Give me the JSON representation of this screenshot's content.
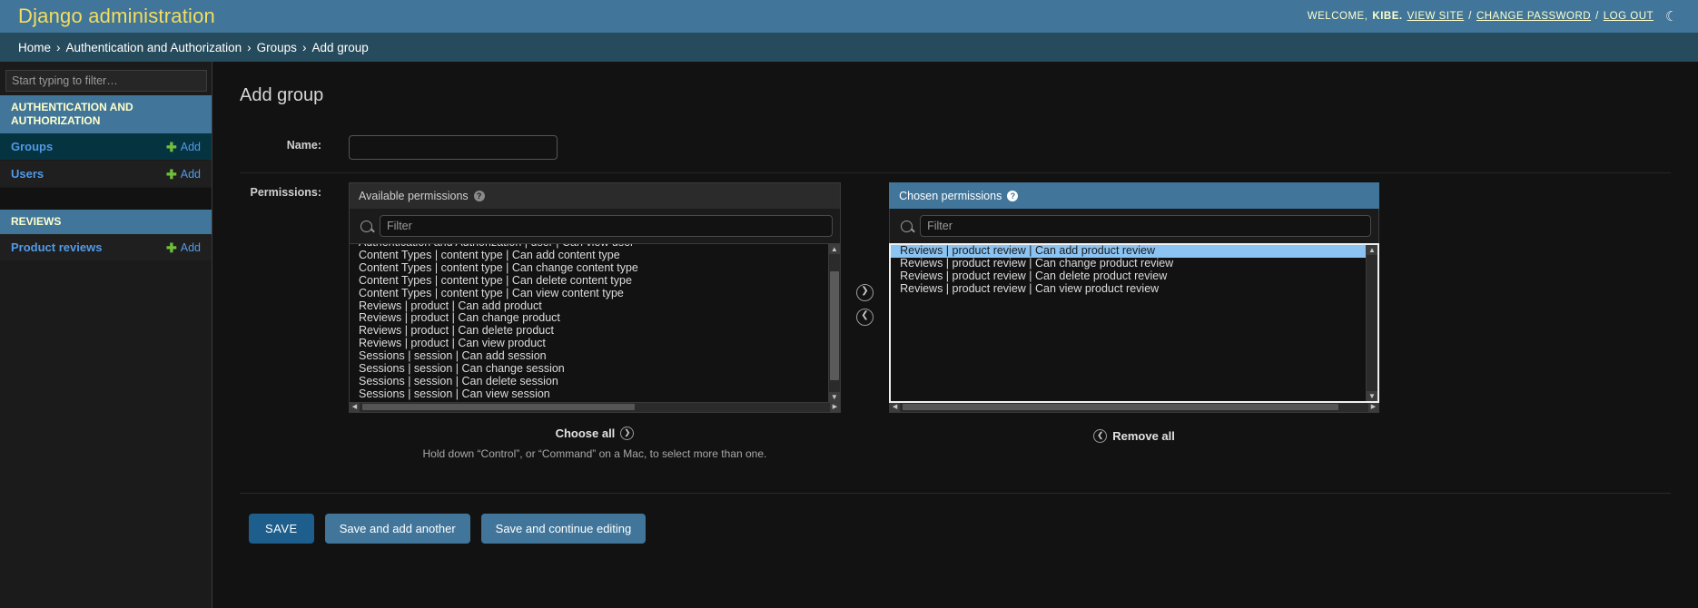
{
  "header": {
    "branding": "Django administration",
    "welcome_prefix": "WELCOME,",
    "username": "KIBE.",
    "view_site": "VIEW SITE",
    "sep1": "/",
    "change_password": "CHANGE PASSWORD",
    "sep2": "/",
    "log_out": "LOG OUT",
    "theme_icon": "☾"
  },
  "breadcrumbs": {
    "home": "Home",
    "sep1": "›",
    "app": "Authentication and Authorization",
    "sep2": "›",
    "model": "Groups",
    "sep3": "›",
    "current": "Add group"
  },
  "sidebar": {
    "filter_placeholder": "Start typing to filter…",
    "filter_value": "",
    "apps": [
      {
        "caption": "AUTHENTICATION AND AUTHORIZATION",
        "models": [
          {
            "name": "Groups",
            "add_label": "Add",
            "current": true
          },
          {
            "name": "Users",
            "add_label": "Add",
            "current": false
          }
        ]
      },
      {
        "caption": "REVIEWS",
        "models": [
          {
            "name": "Product reviews",
            "add_label": "Add",
            "current": false
          }
        ]
      }
    ]
  },
  "main": {
    "title": "Add group",
    "name_label": "Name:",
    "name_value": "",
    "permissions_label": "Permissions:",
    "available": {
      "title": "Available permissions",
      "help_icon": "?",
      "filter_placeholder": "Filter",
      "filter_value": "",
      "options": [
        "Authentication and Authorization | user | Can view user",
        "Content Types | content type | Can add content type",
        "Content Types | content type | Can change content type",
        "Content Types | content type | Can delete content type",
        "Content Types | content type | Can view content type",
        "Reviews | product | Can add product",
        "Reviews | product | Can change product",
        "Reviews | product | Can delete product",
        "Reviews | product | Can view product",
        "Sessions | session | Can add session",
        "Sessions | session | Can change session",
        "Sessions | session | Can delete session",
        "Sessions | session | Can view session"
      ],
      "choose_all": "Choose all",
      "choose_all_icon": "❯",
      "help_text": "Hold down “Control”, or “Command” on a Mac, to select more than one."
    },
    "chosen": {
      "title": "Chosen permissions",
      "help_icon": "?",
      "filter_placeholder": "Filter",
      "filter_value": "",
      "options": [
        {
          "label": "Reviews | product review | Can add product review",
          "selected": true
        },
        {
          "label": "Reviews | product review | Can change product review",
          "selected": false
        },
        {
          "label": "Reviews | product review | Can delete product review",
          "selected": false
        },
        {
          "label": "Reviews | product review | Can view product review",
          "selected": false
        }
      ],
      "remove_all": "Remove all",
      "remove_all_icon": "❮"
    },
    "chooser": {
      "add_icon": "❯",
      "remove_icon": "❮"
    }
  },
  "submit_row": {
    "save": "SAVE",
    "save_and_add_another": "Save and add another",
    "save_and_continue": "Save and continue editing"
  },
  "colors": {
    "header_bg": "#41769a",
    "breadcrumb_bg": "#264b5d",
    "brand_text": "#f5dd5d",
    "link": "#529ae8",
    "plus_green": "#6fbf3c",
    "selected_row": "#8bc4f3",
    "current_model_bg": "#053340",
    "save_button": "#1d5e8c"
  }
}
